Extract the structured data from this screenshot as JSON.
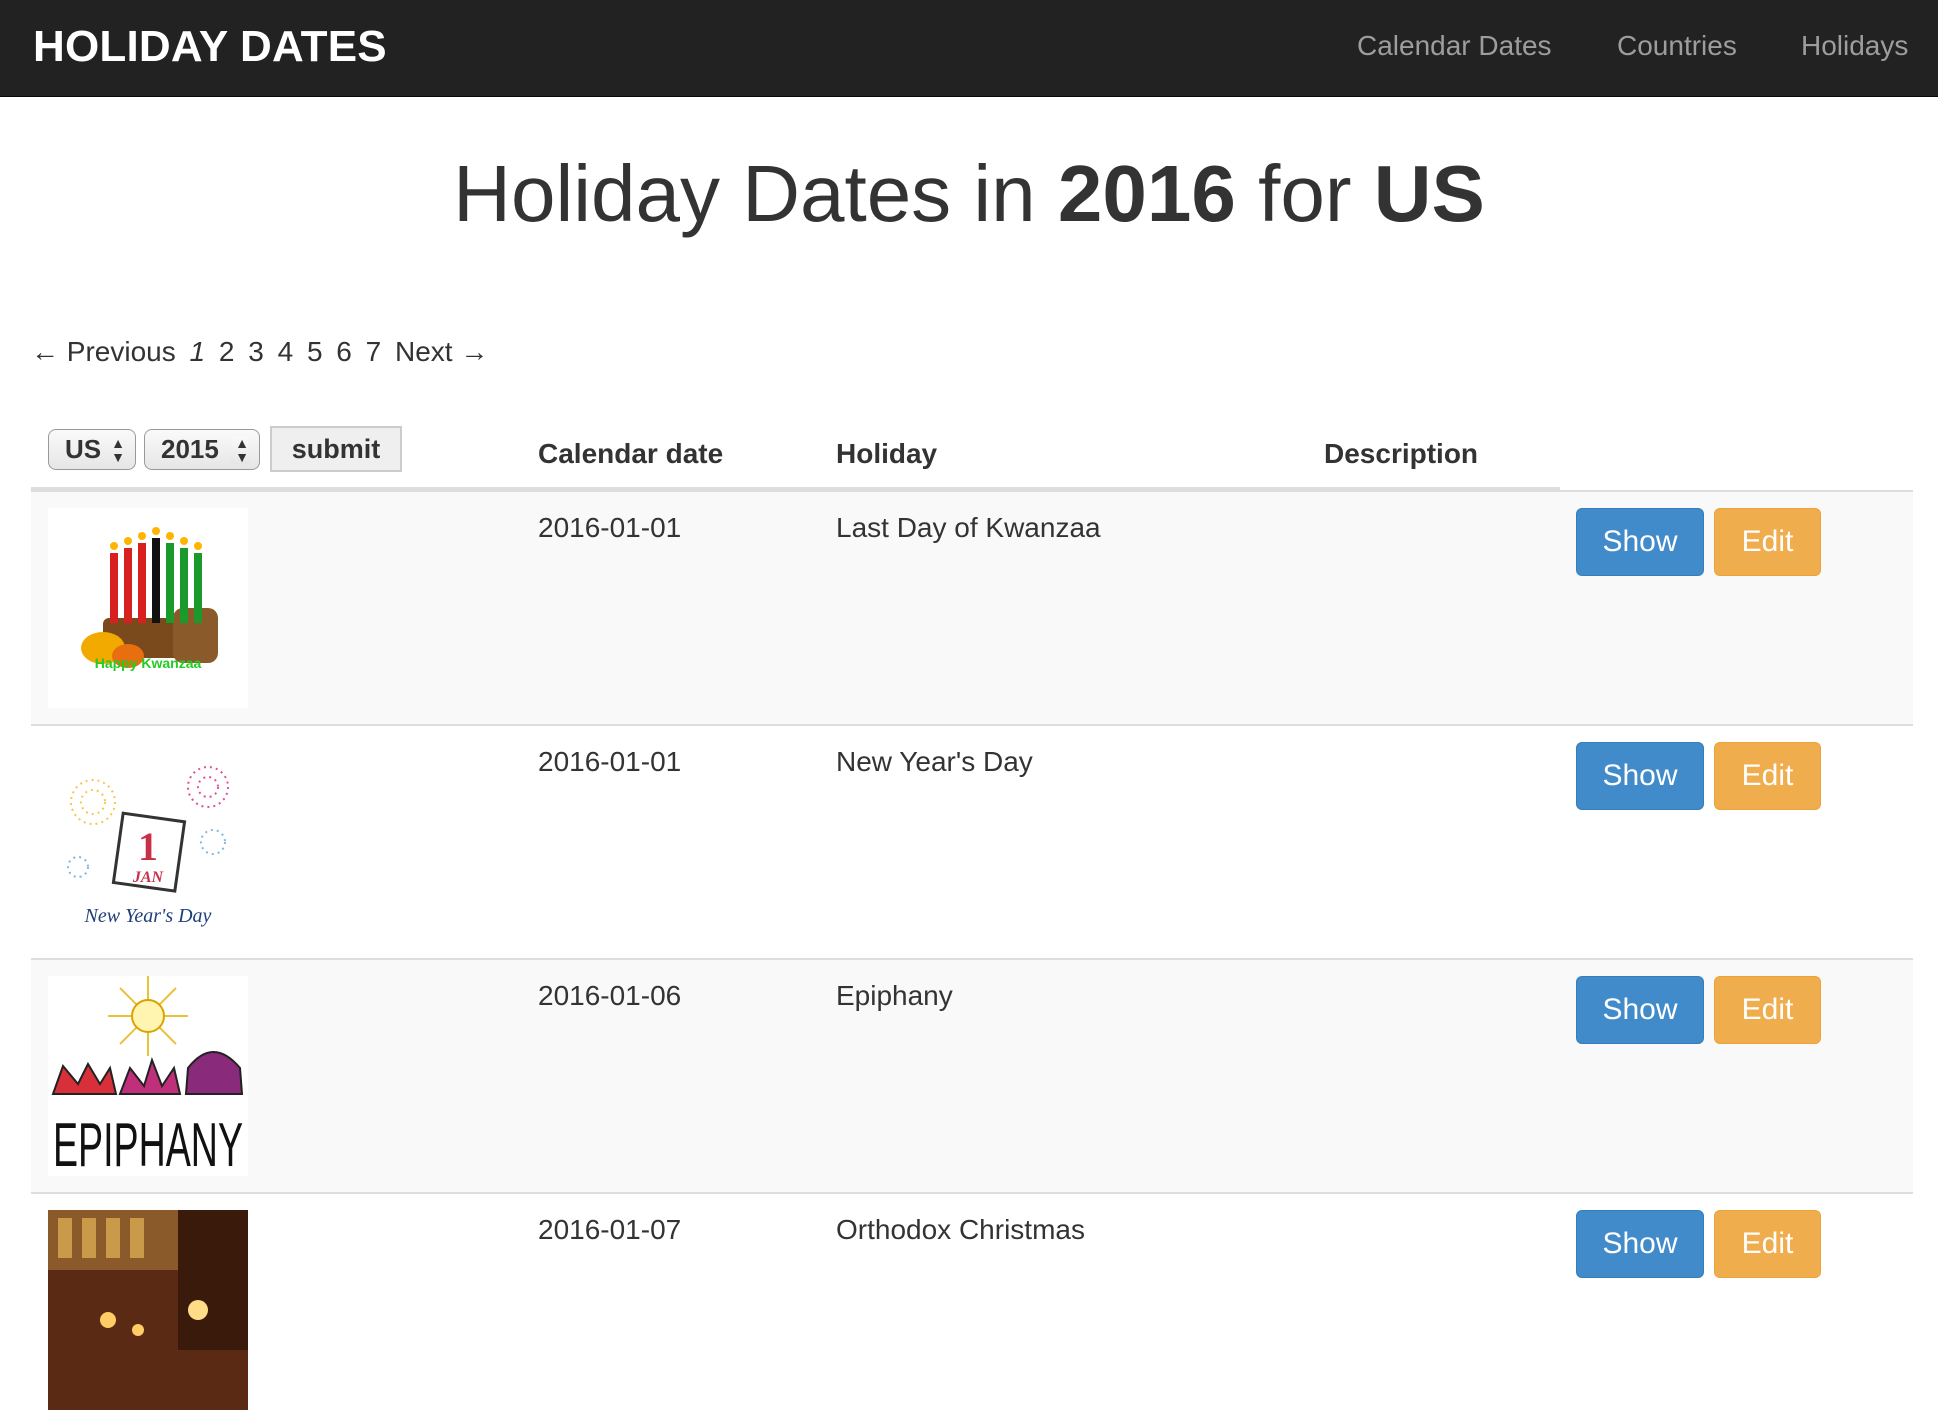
{
  "navbar": {
    "brand": "HOLIDAY DATES",
    "links": [
      "Calendar Dates",
      "Countries",
      "Holidays"
    ]
  },
  "title": {
    "prefix": "Holiday Dates in ",
    "year": "2016",
    "middle": " for ",
    "country": "US"
  },
  "pagination": {
    "previous": "← Previous",
    "pages": [
      "1",
      "2",
      "3",
      "4",
      "5",
      "6",
      "7"
    ],
    "current": "1",
    "next": "Next →"
  },
  "filters": {
    "country_value": "US",
    "year_value": "2015",
    "submit_label": "submit"
  },
  "table": {
    "columns": [
      "Calendar date",
      "Holiday",
      "Description"
    ],
    "rows": [
      {
        "date": "2016-01-01",
        "holiday": "Last Day of Kwanzaa",
        "description": "",
        "image": "kwanzaa-image",
        "image_text": "Happy Kwanzaa"
      },
      {
        "date": "2016-01-01",
        "holiday": "New Year's Day",
        "description": "",
        "image": "new-year-image",
        "image_text": "New Year's Day"
      },
      {
        "date": "2016-01-06",
        "holiday": "Epiphany",
        "description": "",
        "image": "epiphany-image",
        "image_text": "EPIPHANY"
      },
      {
        "date": "2016-01-07",
        "holiday": "Orthodox Christmas",
        "description": "",
        "image": "orthodox-christmas-image",
        "image_text": ""
      }
    ],
    "show_label": "Show",
    "edit_label": "Edit"
  },
  "colors": {
    "navbar": "#222222",
    "show_button": "#428bca",
    "edit_button": "#f0ad4e"
  }
}
